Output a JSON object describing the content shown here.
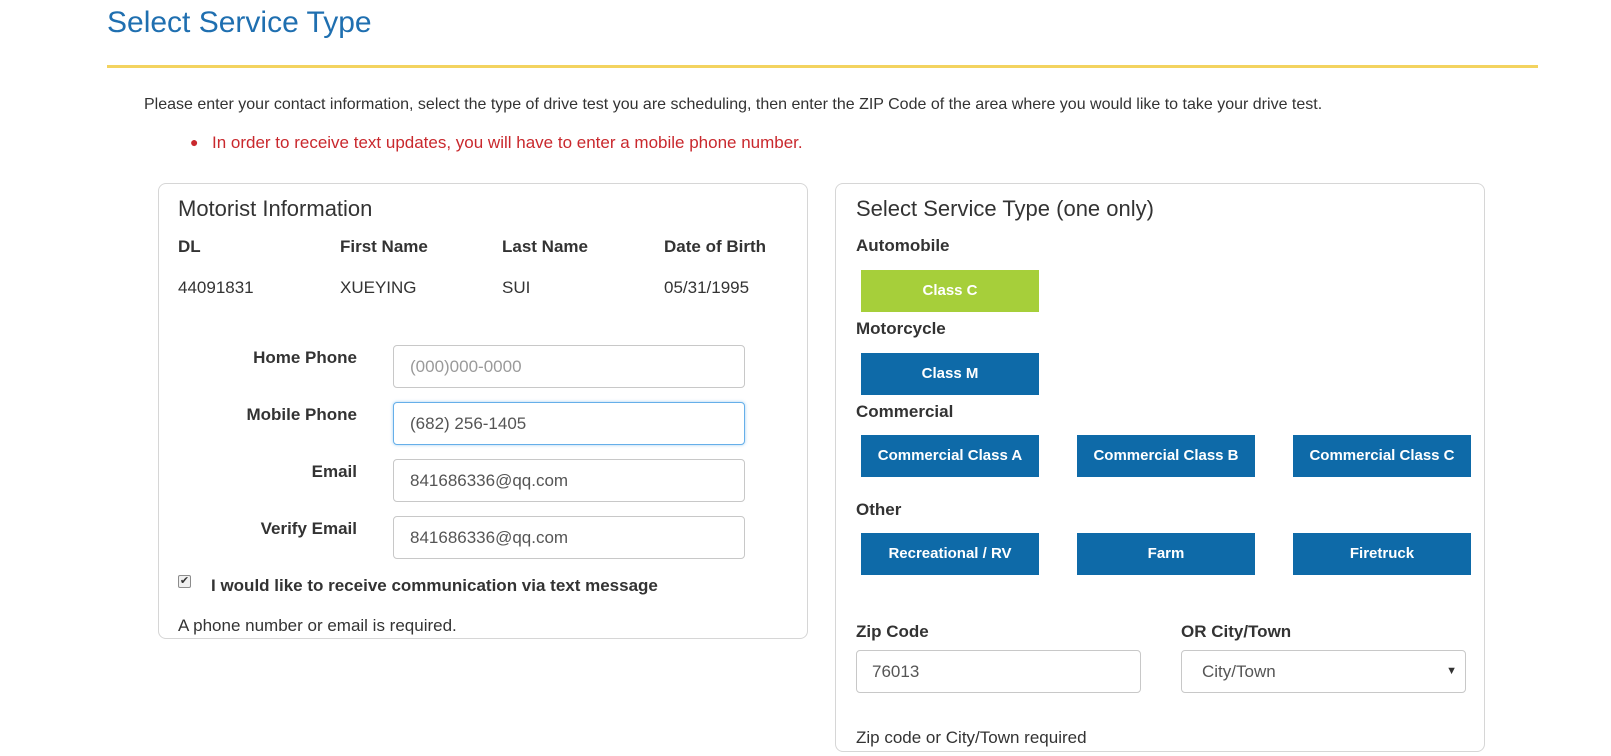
{
  "page": {
    "title": "Select Service Type",
    "intro": "Please enter your contact information, select the type of drive test you are scheduling, then enter the ZIP Code of the area where you would like to take your drive test.",
    "notice": "In order to receive text updates, you will have to enter a mobile phone number."
  },
  "motorist": {
    "heading": "Motorist Information",
    "columns": [
      "DL",
      "First Name",
      "Last Name",
      "Date of Birth"
    ],
    "values": [
      "44091831",
      "XUEYING",
      "SUI",
      "05/31/1995"
    ]
  },
  "contact": {
    "home_phone_label": "Home Phone",
    "home_phone_value": "",
    "home_phone_placeholder": "(000)000-0000",
    "mobile_phone_label": "Mobile Phone",
    "mobile_phone_value": "(682) 256-1405",
    "email_label": "Email",
    "email_value": "841686336@qq.com",
    "verify_email_label": "Verify Email",
    "verify_email_value": "841686336@qq.com",
    "text_opt_in_label": "I would like to receive communication via text message",
    "text_opt_in_checked": true,
    "required_note": "A phone number or email is required."
  },
  "service": {
    "heading": "Select Service Type (one only)",
    "categories": {
      "automobile": "Automobile",
      "motorcycle": "Motorcycle",
      "commercial": "Commercial",
      "other": "Other"
    },
    "buttons": {
      "class_c": "Class C",
      "class_m": "Class M",
      "commercial_a": "Commercial Class A",
      "commercial_b": "Commercial Class B",
      "commercial_c": "Commercial Class C",
      "recreational": "Recreational / RV",
      "farm": "Farm",
      "firetruck": "Firetruck"
    },
    "selected": "Class C"
  },
  "location": {
    "zip_label": "Zip Code",
    "zip_value": "76013",
    "city_label": "OR City/Town",
    "city_selected": "City/Town",
    "note": "Zip code or City/Town required"
  },
  "colors": {
    "title": "#1f6fb0",
    "rule": "#f3d35f",
    "notice": "#c9282d",
    "button": "#0e6aa8",
    "selected_button": "#a6cf3a"
  }
}
